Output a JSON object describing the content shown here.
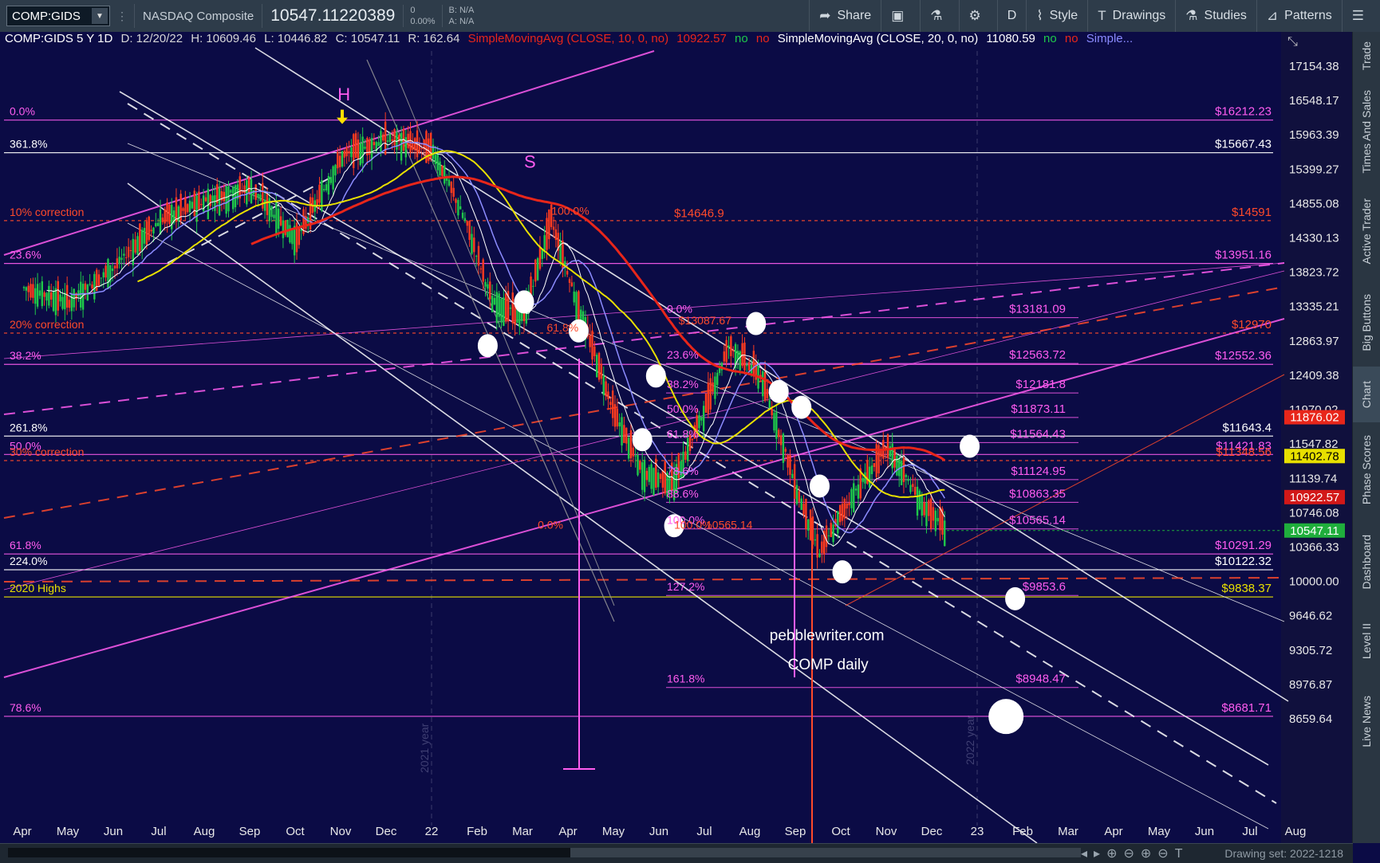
{
  "toolbar": {
    "symbol": "COMP:GIDS",
    "description": "NASDAQ Composite",
    "last_price": "10547.11220389",
    "change": "0",
    "change_pct": "0.00%",
    "bid": "B: N/A",
    "ask": "A: N/A",
    "buttons": [
      "Share",
      "",
      "",
      "",
      "D",
      "Style",
      "Drawings",
      "Studies",
      "Patterns",
      ""
    ]
  },
  "legend": {
    "symbol_period": "COMP:GIDS 5 Y 1D",
    "date": "D: 12/20/22",
    "high": "H: 10609.46",
    "low": "L: 10446.82",
    "close": "C: 10547.11",
    "range": "R: 162.64",
    "sma10": "SimpleMovingAvg (CLOSE, 10, 0, no)",
    "sma10_value": "10922.57",
    "sma20": "SimpleMovingAvg (CLOSE, 20, 0, no)",
    "sma20_value": "11080.59",
    "no1": "no",
    "no2": "no",
    "more": "Simple..."
  },
  "right_panel": [
    "Trade",
    "Times And Sales",
    "Active Trader",
    "Big Buttons",
    "Chart",
    "Phase Scores",
    "Dashboard",
    "Level II",
    "Live News"
  ],
  "bottom": {
    "drawing_set": "Drawing set: 2022-1218"
  },
  "chart_data": {
    "type": "candlestick",
    "y_axis_ticks": [
      17154.38,
      16548.17,
      15963.39,
      15399.27,
      14855.08,
      14330.13,
      13823.72,
      13335.21,
      12863.97,
      12409.38,
      11970.02,
      11547.82,
      11139.74,
      10746.08,
      10366.33,
      10000,
      9646.62,
      9305.72,
      8976.87,
      8659.64
    ],
    "x_axis_ticks": [
      "Apr",
      "May",
      "Jun",
      "Jul",
      "Aug",
      "Sep",
      "Oct",
      "Nov",
      "Dec",
      "22",
      "Feb",
      "Mar",
      "Apr",
      "May",
      "Jun",
      "Jul",
      "Aug",
      "Sep",
      "Oct",
      "Nov",
      "Dec",
      "23",
      "Feb",
      "Mar",
      "Apr",
      "May",
      "Jun",
      "Jul",
      "Aug"
    ],
    "year_labels": [
      "2021 year",
      "2022 year"
    ],
    "price_tags": [
      {
        "value": "11876.02",
        "color": "#e8261a"
      },
      {
        "value": "11402.78",
        "color": "#e8e000"
      },
      {
        "value": "10922.57",
        "color": "#d21818"
      },
      {
        "value": "10547.11",
        "color": "#1fae3c"
      }
    ],
    "levels": [
      {
        "left": "0.0%",
        "right": "$16212.23",
        "price": 16212.23,
        "color": "#ff5cf0"
      },
      {
        "left": "361.8%",
        "right": "$15667.43",
        "price": 15667.43,
        "color": "#ffffff"
      },
      {
        "left": "10% correction",
        "right": "$14591",
        "price": 14591,
        "color": "#ff4a2a"
      },
      {
        "left": "23.6%",
        "right": "$13951.16",
        "price": 13951.16,
        "color": "#ff5cf0"
      },
      {
        "left": "20% correction",
        "right": "$12970",
        "price": 12970,
        "color": "#ff4a2a"
      },
      {
        "left": "38.2%",
        "right": "$12552.36",
        "price": 12552.36,
        "color": "#ff5cf0"
      },
      {
        "left": "261.8%",
        "right": "$11643.4",
        "price": 11643.4,
        "color": "#ffffff"
      },
      {
        "left": "50.0%",
        "right": "$11421.83",
        "price": 11421.83,
        "color": "#ff5cf0"
      },
      {
        "left": "30% correction",
        "right": "$11348.56",
        "price": 11348.56,
        "color": "#ff4a2a"
      },
      {
        "left": "61.8%",
        "right": "$10291.29",
        "price": 10291.29,
        "color": "#ff5cf0"
      },
      {
        "left": "224.0%",
        "right": "$10122.32",
        "price": 10122.32,
        "color": "#ffffff"
      },
      {
        "left": "2020 Highs",
        "right": "$9838.37",
        "price": 9838.37,
        "color": "#e8e000"
      },
      {
        "left": "78.6%",
        "right": "$8681.71",
        "price": 8681.71,
        "color": "#ff5cf0"
      }
    ],
    "fib_inner": [
      {
        "pct": "0.0%",
        "value": "$13181.09",
        "price": 13181.09
      },
      {
        "pct": "23.6%",
        "value": "$12563.72",
        "price": 12563.72
      },
      {
        "pct": "38.2%",
        "value": "$12181.8",
        "price": 12181.8
      },
      {
        "pct": "50.0%",
        "value": "$11873.11",
        "price": 11873.11
      },
      {
        "pct": "61.8%",
        "value": "$11564.43",
        "price": 11564.43
      },
      {
        "pct": "78.6%",
        "value": "$11124.95",
        "price": 11124.95
      },
      {
        "pct": "88.6%",
        "value": "$10863.35",
        "price": 10863.35
      },
      {
        "pct": "100.0%",
        "value": "$10565.14",
        "price": 10565.14
      },
      {
        "pct": "127.2%",
        "value": "$9853.6",
        "price": 9853.6
      },
      {
        "pct": "161.8%",
        "value": "$8948.47",
        "price": 8948.47
      }
    ],
    "annotations": [
      {
        "text": "H",
        "price": 16550
      },
      {
        "text": "S",
        "price": 15420
      },
      {
        "text": "100.0%",
        "price": 14680
      },
      {
        "text": "$14646.9",
        "price": 14646.9
      },
      {
        "text": "61.8%",
        "price": 12990
      },
      {
        "text": "$13087.67",
        "price": 13087.67
      },
      {
        "text": "0.0%",
        "price": 10565
      },
      {
        "text": "100.0%",
        "price": 10565
      },
      {
        "text": "10565.14",
        "price": 10565.14
      },
      {
        "text": "pebblewriter.com",
        "price": 9400
      },
      {
        "text": "COMP daily",
        "price": 9120
      }
    ],
    "last_close": 10547.11,
    "sma10_last": 10922.57,
    "sma20_last": 11080.59
  }
}
